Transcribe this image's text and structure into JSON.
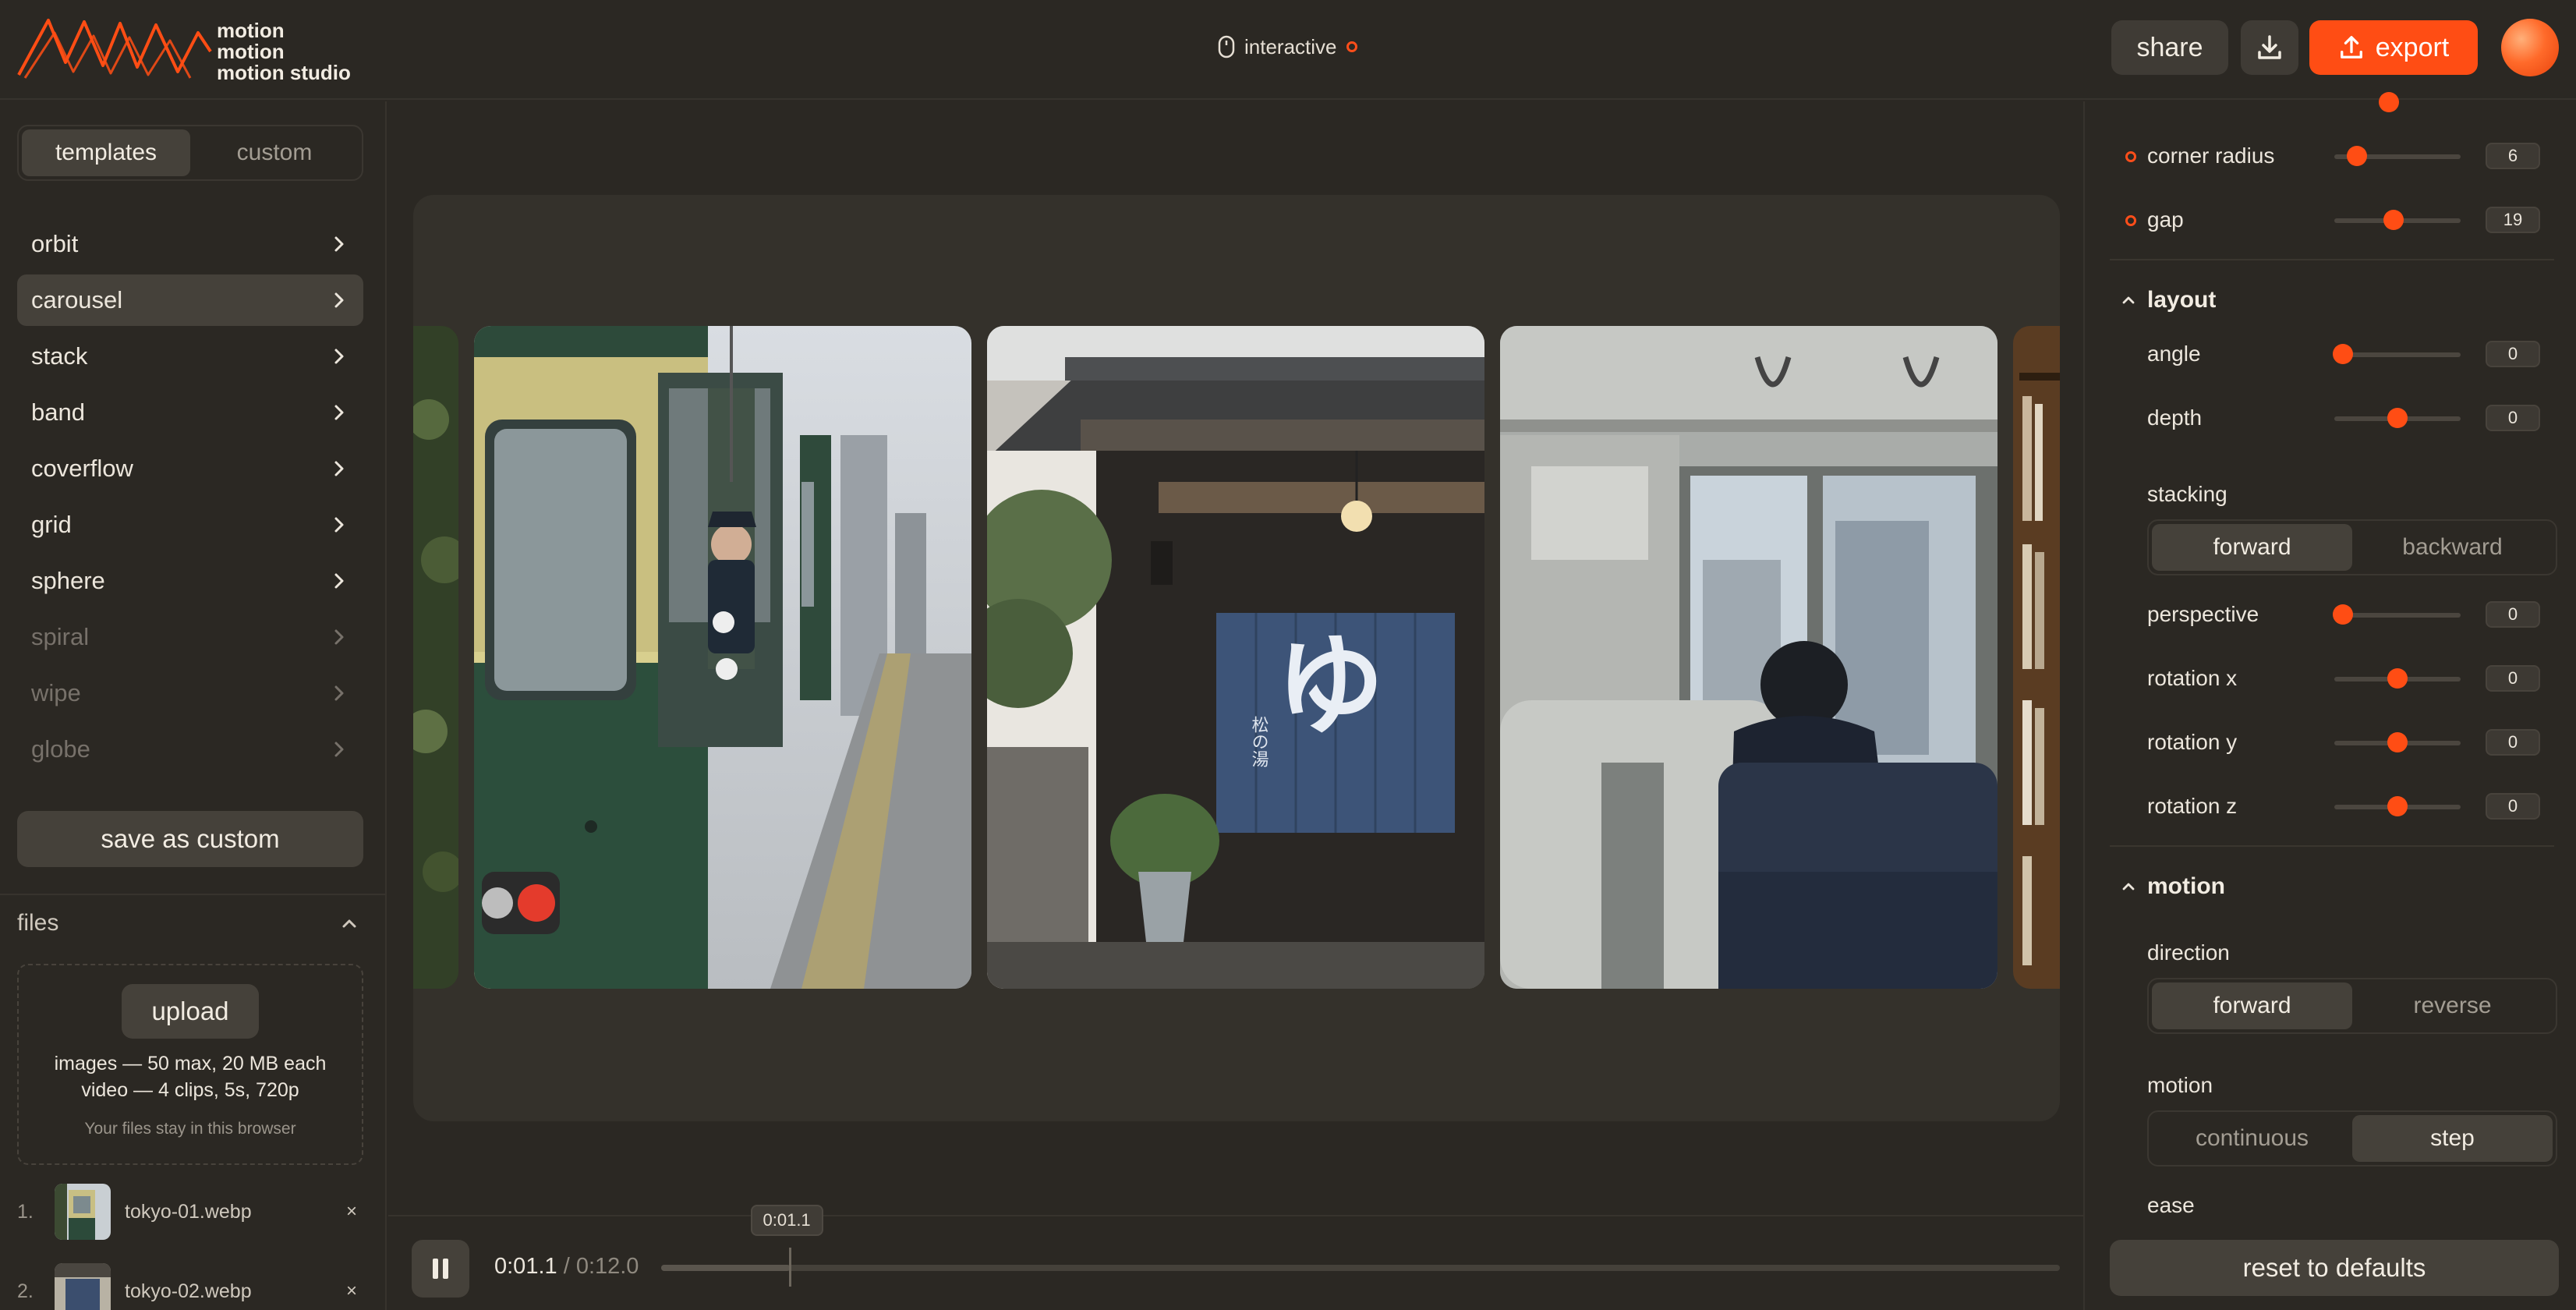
{
  "header": {
    "logo_lines": [
      "motion",
      "motion",
      "motion studio"
    ],
    "mode_label": "interactive",
    "share_label": "share",
    "export_label": "export",
    "download_icon": "download-icon",
    "accent": "#ff4d14"
  },
  "sidebar": {
    "tabs": [
      {
        "label": "templates",
        "active": true
      },
      {
        "label": "custom",
        "active": false
      }
    ],
    "templates": [
      {
        "label": "orbit",
        "state": "normal"
      },
      {
        "label": "carousel",
        "state": "selected"
      },
      {
        "label": "stack",
        "state": "normal"
      },
      {
        "label": "band",
        "state": "normal"
      },
      {
        "label": "coverflow",
        "state": "normal"
      },
      {
        "label": "grid",
        "state": "normal"
      },
      {
        "label": "sphere",
        "state": "normal"
      },
      {
        "label": "spiral",
        "state": "disabled"
      },
      {
        "label": "wipe",
        "state": "disabled"
      },
      {
        "label": "globe",
        "state": "disabled"
      }
    ],
    "save_label": "save as custom"
  },
  "files": {
    "title": "files",
    "upload_label": "upload",
    "limits_images": "images — 50 max, 20 MB each",
    "limits_video": "video — 4 clips, 5s, 720p",
    "privacy_note": "Your files stay in this browser",
    "items": [
      {
        "index": "1.",
        "name": "tokyo-01.webp"
      },
      {
        "index": "2.",
        "name": "tokyo-02.webp"
      }
    ],
    "remove_glyph": "×"
  },
  "timeline": {
    "current": "0:01.1",
    "separator": " / ",
    "total": "0:12.0",
    "tooltip": "0:01.1",
    "progress": 0.0917
  },
  "controls": {
    "top": [
      {
        "label": "corner radius",
        "value": "6",
        "pos": 0.18
      },
      {
        "label": "gap",
        "value": "19",
        "pos": 0.47
      }
    ],
    "layout": {
      "title": "layout",
      "sliders_a": [
        {
          "label": "angle",
          "value": "0",
          "pos": 0.07
        },
        {
          "label": "depth",
          "value": "0",
          "pos": 0.5
        }
      ],
      "stacking": {
        "label": "stacking",
        "options": [
          "forward",
          "backward"
        ],
        "active": 0
      },
      "sliders_b": [
        {
          "label": "perspective",
          "value": "0",
          "pos": 0.07
        },
        {
          "label": "rotation x",
          "value": "0",
          "pos": 0.5
        },
        {
          "label": "rotation y",
          "value": "0",
          "pos": 0.5
        },
        {
          "label": "rotation z",
          "value": "0",
          "pos": 0.5
        }
      ]
    },
    "motion": {
      "title": "motion",
      "direction": {
        "label": "direction",
        "options": [
          "forward",
          "reverse"
        ],
        "active": 0
      },
      "motion_type": {
        "label": "motion",
        "options": [
          "continuous",
          "step"
        ],
        "active": 1
      },
      "ease_label": "ease"
    },
    "reset_label": "reset to defaults"
  },
  "stage": {
    "curtain_text": "ゆ",
    "curtain_subtext": "松の湯"
  }
}
